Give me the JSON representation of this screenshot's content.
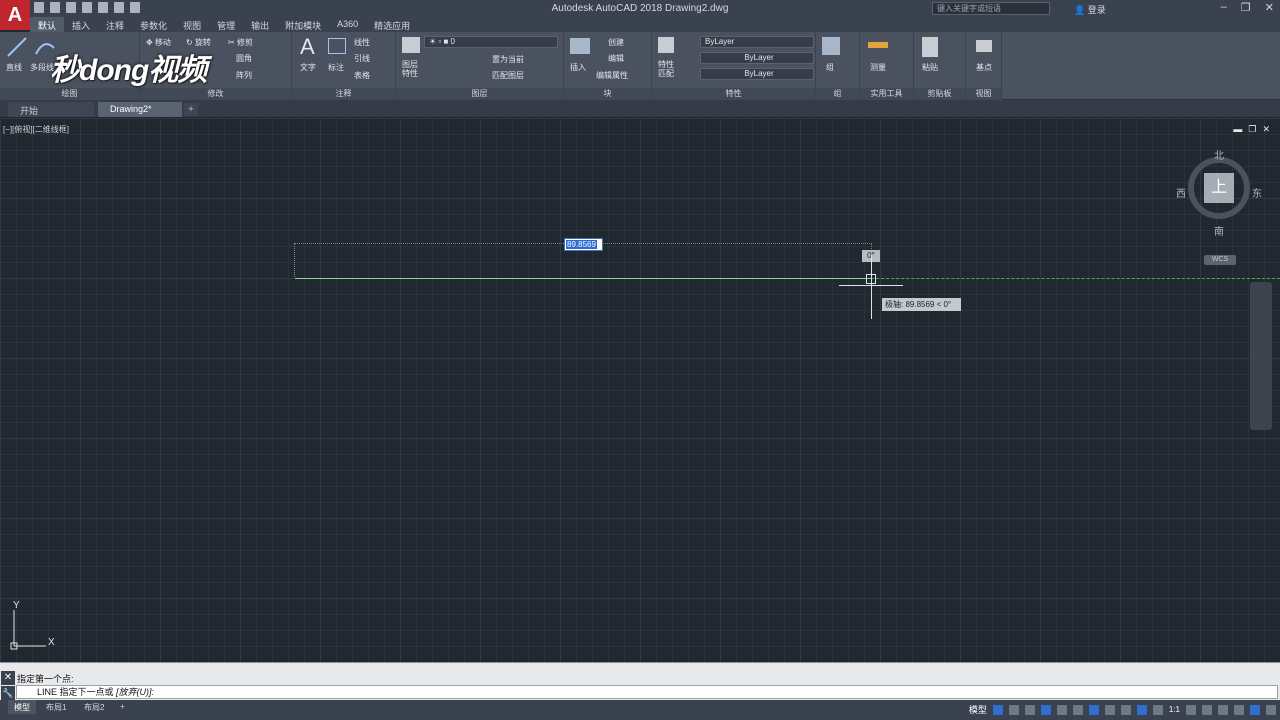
{
  "app": {
    "logo": "A",
    "title": "Autodesk AutoCAD 2018    Drawing2.dwg",
    "search_placeholder": "键入关键字或短语",
    "login": "登录"
  },
  "ribbon_tabs": [
    "默认",
    "插入",
    "注释",
    "参数化",
    "视图",
    "管理",
    "输出",
    "附加模块",
    "A360",
    "精选应用"
  ],
  "ribbon": {
    "draw": {
      "line": "直线",
      "polyline": "多段线",
      "title": "绘图"
    },
    "modify": {
      "move": "移动",
      "rotate": "旋转",
      "trim": "修剪",
      "fillet": "圆角",
      "array": "阵列",
      "title": "修改"
    },
    "annotation": {
      "text": "文字",
      "dimension": "标注",
      "linear": "线性",
      "leader": "引线",
      "table": "表格",
      "title": "注释"
    },
    "layers": {
      "layer_props": "图层\n特性",
      "layer_value": "0",
      "set_current": "置为当前",
      "match_layer": "匹配图层",
      "title": "图层"
    },
    "block": {
      "insert": "插入",
      "create": "创建",
      "edit": "编辑",
      "edit_attr": "编辑属性",
      "title": "块"
    },
    "properties": {
      "match": "特性\n匹配",
      "color": "ByLayer",
      "linetype": "ByLayer",
      "lineweight": "ByLayer",
      "title": "特性"
    },
    "groups": {
      "group": "组",
      "title": "组"
    },
    "utilities": {
      "measure": "测量",
      "title": "实用工具"
    },
    "clipboard": {
      "paste": "粘贴",
      "title": "剪贴板"
    },
    "view": {
      "base": "基点",
      "title": "视图"
    }
  },
  "doc_tabs": {
    "start": "开始",
    "drawing": "Drawing2*",
    "add": "+"
  },
  "viewport": {
    "label": "[−][俯视][二维线框]",
    "length_value": "89.8569",
    "angle_value": "0°",
    "polar_tooltip": "极轴: 89.8569 < 0°"
  },
  "viewcube": {
    "north": "北",
    "south": "南",
    "east": "东",
    "west": "西",
    "face": "上",
    "wcs": "WCS"
  },
  "ucs": {
    "x": "X",
    "y": "Y"
  },
  "command": {
    "history": "指定第一个点:",
    "prompt": "LINE 指定下一点或",
    "option": "[放弃(U)]:"
  },
  "status": {
    "model_tab": "模型",
    "layout1": "布局1",
    "layout2": "布局2",
    "add": "+",
    "model_mode": "模型",
    "scale": "1:1"
  },
  "watermark": "秒dong视频"
}
